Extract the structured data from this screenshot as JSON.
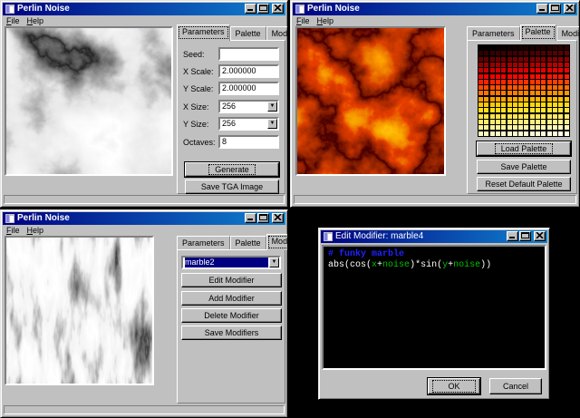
{
  "win1": {
    "title": "Perlin Noise",
    "menu": [
      "File",
      "Help"
    ],
    "tabs": [
      "Parameters",
      "Palette",
      "Modifiers"
    ],
    "active_tab": "Parameters",
    "fields": {
      "seed": {
        "label": "Seed:",
        "value": ""
      },
      "xscale": {
        "label": "X Scale:",
        "value": "2.000000"
      },
      "yscale": {
        "label": "Y Scale:",
        "value": "2.000000"
      },
      "xsize": {
        "label": "X Size:",
        "value": "256"
      },
      "ysize": {
        "label": "Y Size:",
        "value": "256"
      },
      "octaves": {
        "label": "Octaves:",
        "value": "8"
      }
    },
    "generate_label": "Generate",
    "save_tga_label": "Save TGA Image"
  },
  "win2": {
    "title": "Perlin Noise",
    "menu": [
      "File",
      "Help"
    ],
    "tabs": [
      "Parameters",
      "Palette",
      "Modifiers"
    ],
    "active_tab": "Palette",
    "load_palette_label": "Load Palette",
    "save_palette_label": "Save Palette",
    "reset_palette_label": "Reset Default Palette"
  },
  "win3": {
    "title": "Perlin Noise",
    "menu": [
      "File",
      "Help"
    ],
    "tabs": [
      "Parameters",
      "Palette",
      "Modifiers"
    ],
    "active_tab": "Modifiers",
    "modifier_selected": "marble2",
    "edit_modifier_label": "Edit Modifier",
    "add_modifier_label": "Add Modifier",
    "delete_modifier_label": "Delete Modifier",
    "save_modifiers_label": "Save Modifiers"
  },
  "dialog": {
    "title": "Edit Modifier: marble4",
    "code_comment": "# funky marble",
    "code_expression": [
      {
        "t": "abs(cos(",
        "c": "#ffffff"
      },
      {
        "t": "x",
        "c": "#00c000"
      },
      {
        "t": "+",
        "c": "#ffffff"
      },
      {
        "t": "noise",
        "c": "#00c000"
      },
      {
        "t": ")*sin(",
        "c": "#ffffff"
      },
      {
        "t": "y",
        "c": "#00c000"
      },
      {
        "t": "+",
        "c": "#ffffff"
      },
      {
        "t": "noise",
        "c": "#00c000"
      },
      {
        "t": "))",
        "c": "#ffffff"
      }
    ],
    "ok_label": "OK",
    "cancel_label": "Cancel"
  },
  "colors": {
    "titlebar_start": "#000080",
    "titlebar_end": "#1084d0",
    "window_face": "#c0c0c0",
    "code_comment": "#2020ff"
  },
  "icons": [
    "app-icon",
    "minimize-icon",
    "maximize-icon",
    "close-icon",
    "dropdown-arrow-icon"
  ]
}
